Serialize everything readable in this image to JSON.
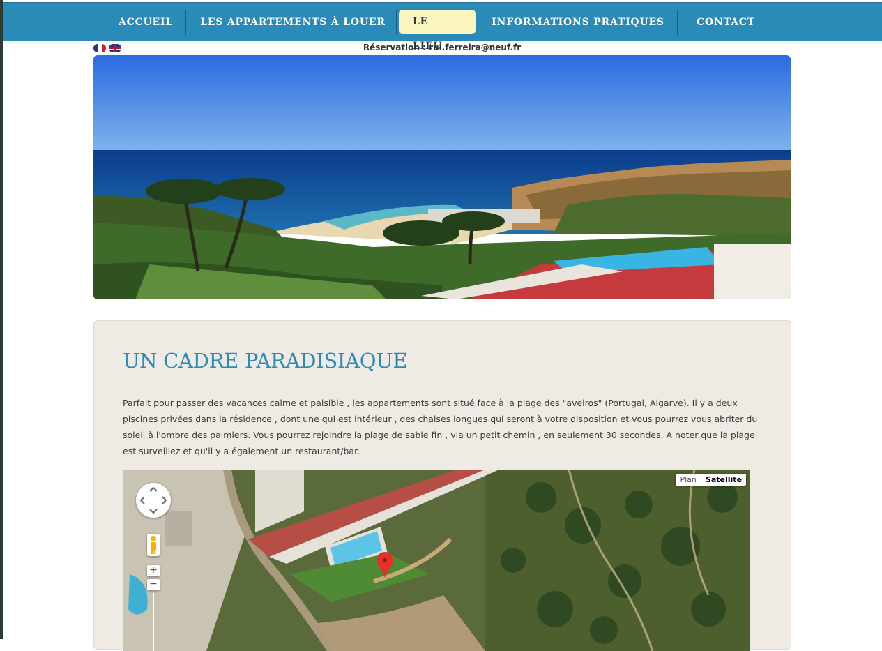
{
  "nav": {
    "items": [
      {
        "label": "ACCUEIL"
      },
      {
        "label": "LES APPARTEMENTS À LOUER"
      },
      {
        "label": "LE LIEU",
        "active": true
      },
      {
        "label": "INFORMATIONS PRATIQUES"
      },
      {
        "label": "CONTACT"
      }
    ]
  },
  "languages": [
    "fr",
    "en"
  ],
  "reservation": "Réservation : rui.ferreira@neuf.fr",
  "section": {
    "title": "UN CADRE PARADISIAQUE",
    "text": "Parfait pour passer des vacances calme et paisible , les appartements sont situé face à la plage des \"aveiros\" (Portugal, Algarve). Il y a deux piscines privées dans la résidence , dont une qui est intérieur , des chaises longues qui seront à votre disposition et vous pourrez vous abriter du soleil à l'ombre des palmiers. Vous pourrez rejoindre la plage de sable fin , via un petit chemin , en seulement 30 secondes. A noter que la plage est surveillez et qu'il y a également un restaurant/bar."
  },
  "map": {
    "type_plan": "Plan",
    "type_satellite": "Satellite",
    "selected_type": "Satellite",
    "zoom_in": "+",
    "zoom_out": "−"
  },
  "colors": {
    "nav_bg": "#2a8ab8",
    "active_bg": "#fbf5c0",
    "title": "#2a8ab8",
    "panel_bg": "#efeae3"
  }
}
